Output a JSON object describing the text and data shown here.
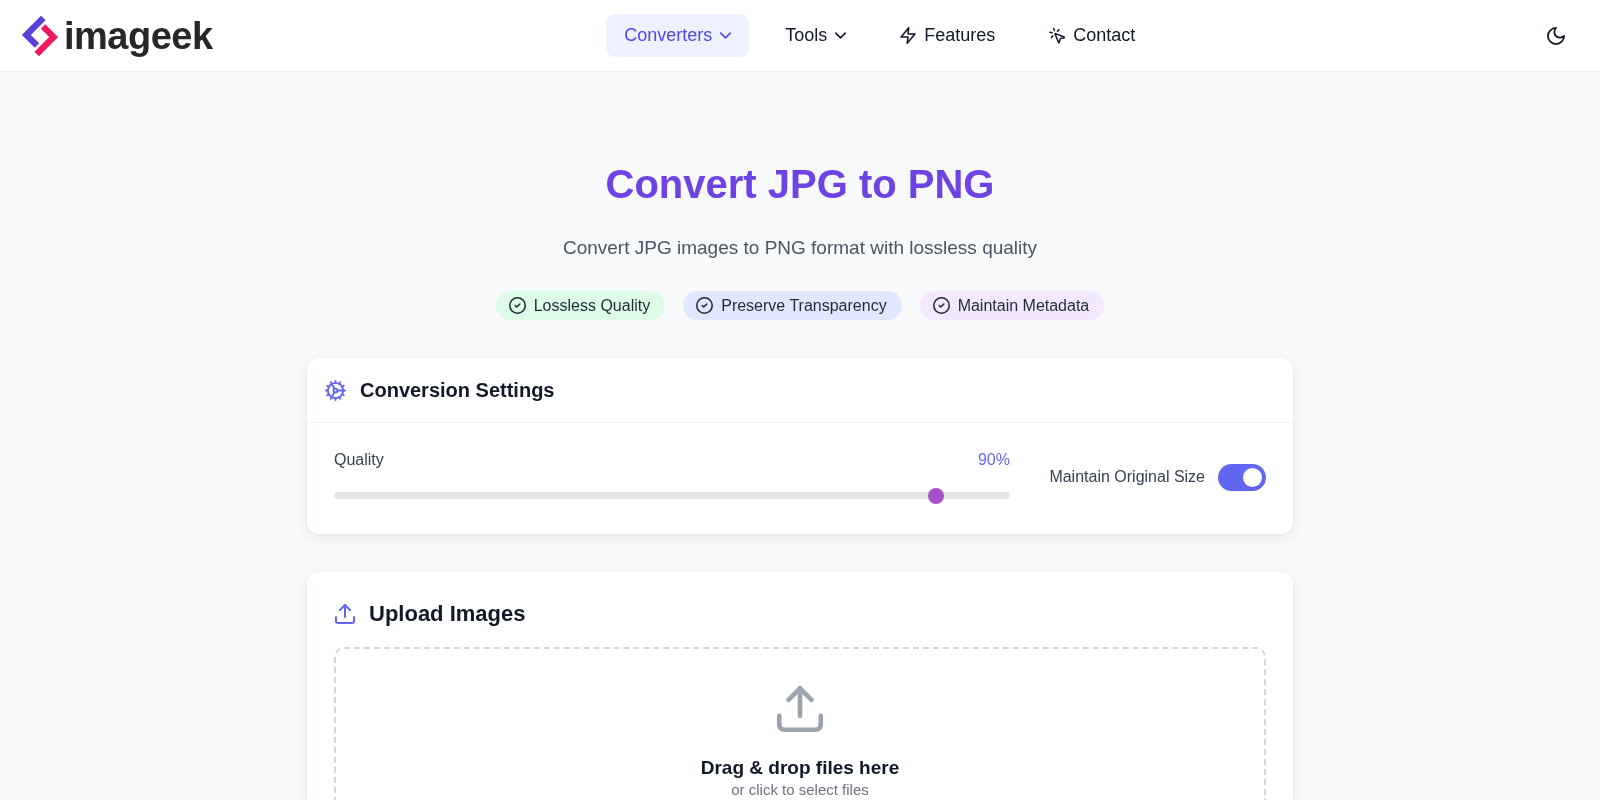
{
  "header": {
    "logo": {
      "text": "imageek"
    },
    "nav": [
      {
        "label": "Converters",
        "kind": "menu",
        "selected": true
      },
      {
        "label": "Tools",
        "kind": "menu",
        "selected": false
      },
      {
        "label": "Features",
        "kind": "link",
        "selected": false
      },
      {
        "label": "Contact",
        "kind": "link",
        "selected": false
      }
    ]
  },
  "hero": {
    "title": "Convert JPG to PNG",
    "subtitle": "Convert JPG images to PNG format with lossless quality",
    "badges": [
      {
        "label": "Lossless Quality",
        "color": "#dcfce7"
      },
      {
        "label": "Preserve Transparency",
        "color": "#e0e7ff"
      },
      {
        "label": "Maintain Metadata",
        "color": "#f3e8ff"
      }
    ]
  },
  "settings": {
    "title": "Conversion Settings",
    "quality": {
      "label": "Quality",
      "reading": "90%",
      "level": 0.9
    },
    "maintain_size": {
      "label": "Maintain Original Size",
      "on": true
    }
  },
  "upload": {
    "title": "Upload Images",
    "dropzone": {
      "title": "Drag & drop files here",
      "hint": "or click to select files"
    }
  }
}
